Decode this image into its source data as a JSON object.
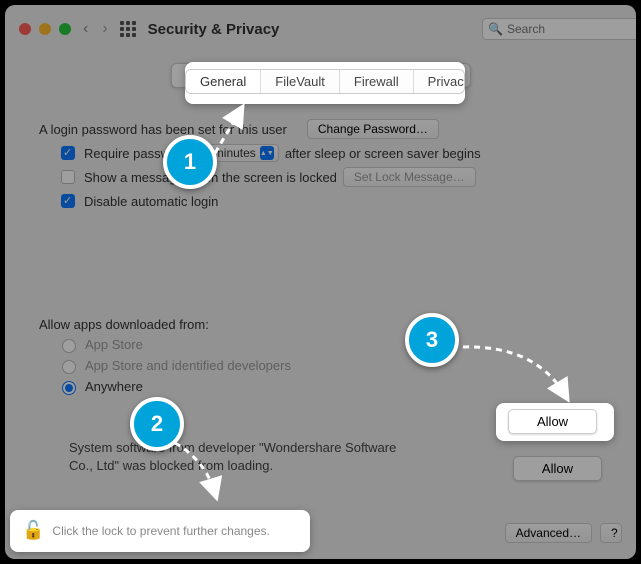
{
  "window": {
    "title": "Security & Privacy",
    "search_placeholder": "Search"
  },
  "tabs": [
    "General",
    "FileVault",
    "Firewall",
    "Privacy"
  ],
  "active_tab": 0,
  "login": {
    "text": "A login password has been set for this user",
    "change_btn": "Change Password…",
    "require_label_pre": "Require password",
    "require_value": "5 minutes",
    "require_label_post": "after sleep or screen saver begins",
    "show_msg_label": "Show a message when the screen is locked",
    "set_msg_btn": "Set Lock Message…",
    "disable_auto_label": "Disable automatic login"
  },
  "allow_section": {
    "heading": "Allow apps downloaded from:",
    "options": [
      "App Store",
      "App Store and identified developers",
      "Anywhere"
    ],
    "selected": 2
  },
  "blocked": {
    "text": "System software from developer \"Wondershare Software Co., Ltd\" was blocked from loading.",
    "allow_btn": "Allow"
  },
  "footer": {
    "lock_text": "Click the lock to prevent further changes.",
    "advanced_btn": "Advanced…",
    "help": "?"
  },
  "steps": {
    "1": "1",
    "2": "2",
    "3": "3"
  }
}
